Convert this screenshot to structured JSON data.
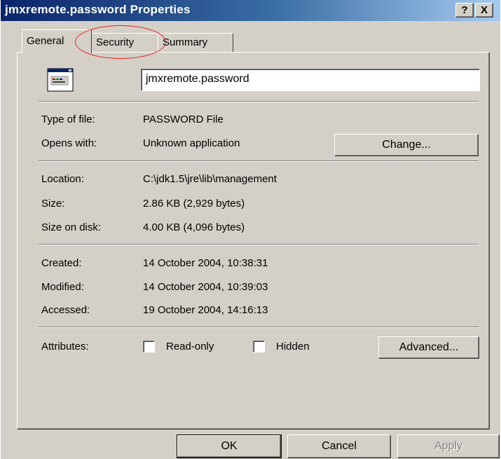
{
  "window": {
    "title": "jmxremote.password Properties",
    "help_button": "?",
    "close_button": "X"
  },
  "tabs": [
    {
      "label": "General",
      "active": true
    },
    {
      "label": "Security",
      "active": false
    },
    {
      "label": "Summary",
      "active": false
    }
  ],
  "general": {
    "file_name": "jmxremote.password",
    "type_label": "Type of file:",
    "type_value": "PASSWORD File",
    "opens_label": "Opens with:",
    "opens_value": "Unknown application",
    "change_button": "Change...",
    "location_label": "Location:",
    "location_value": "C:\\jdk1.5\\jre\\lib\\management",
    "size_label": "Size:",
    "size_value": "2.86 KB (2,929 bytes)",
    "size_disk_label": "Size on disk:",
    "size_disk_value": "4.00 KB (4,096 bytes)",
    "created_label": "Created:",
    "created_value": "14 October 2004, 10:38:31",
    "modified_label": "Modified:",
    "modified_value": "14 October 2004, 10:39:03",
    "accessed_label": "Accessed:",
    "accessed_value": "19 October 2004, 14:16:13",
    "attributes_label": "Attributes:",
    "readonly_label": "Read-only",
    "readonly_checked": false,
    "hidden_label": "Hidden",
    "hidden_checked": false,
    "advanced_button": "Advanced..."
  },
  "footer": {
    "ok_button": "OK",
    "cancel_button": "Cancel",
    "apply_button": "Apply"
  },
  "colors": {
    "annotation": "#e02020",
    "titlebar": "#0a246a",
    "face": "#d4d0c8"
  },
  "icons": {
    "file": "generic-file-icon"
  }
}
